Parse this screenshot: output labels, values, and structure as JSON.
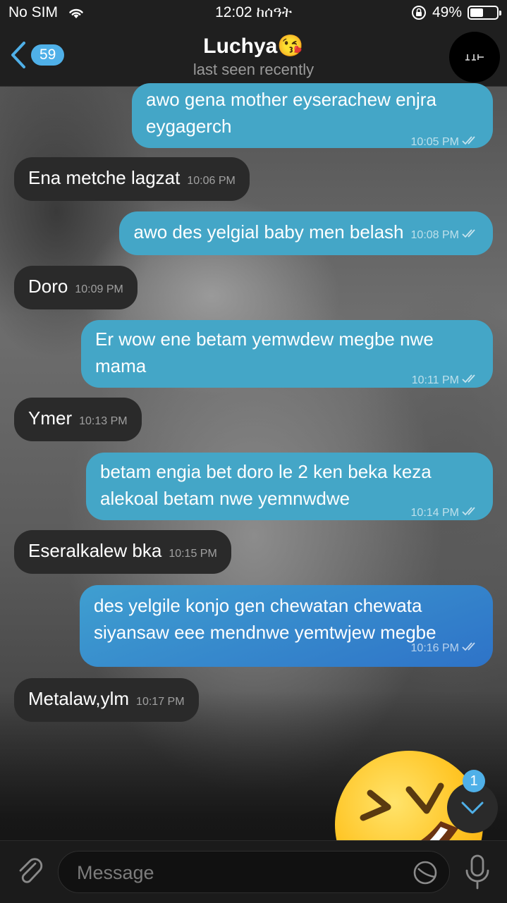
{
  "status_bar": {
    "carrier": "No SIM",
    "time": "12:02 ከሰዓት",
    "battery": "49%",
    "battery_level": 0.49
  },
  "header": {
    "back_count": "59",
    "title": "Luchya😘",
    "subtitle": "last seen recently"
  },
  "messages": [
    {
      "dir": "out",
      "text": "awo gena mother eyserachew enjra eygagerch",
      "time": "10:05 PM"
    },
    {
      "dir": "in",
      "text": "Ena metche lagzat",
      "time": "10:06 PM"
    },
    {
      "dir": "out",
      "text": "awo des yelgial baby men belash",
      "time": "10:08 PM"
    },
    {
      "dir": "in",
      "text": "Doro",
      "time": "10:09 PM"
    },
    {
      "dir": "out",
      "text": "Er wow ene betam yemwdew megbe nwe mama",
      "time": "10:11 PM"
    },
    {
      "dir": "in",
      "text": "Ymer",
      "time": "10:13 PM"
    },
    {
      "dir": "out",
      "text": "betam engia bet doro le 2 ken beka keza alekoal betam nwe yemnwdwe",
      "time": "10:14 PM"
    },
    {
      "dir": "in",
      "text": "Eseralkalew bka",
      "time": "10:15 PM"
    },
    {
      "dir": "out",
      "text": "des yelgile konjo gen chewatan chewata siyansaw eee mendnwe yemtwjew megbe",
      "time": "10:16 PM"
    },
    {
      "dir": "in",
      "text": "Metalaw,ylm",
      "time": "10:17 PM"
    }
  ],
  "scroll": {
    "unread": "1"
  },
  "input": {
    "placeholder": "Message"
  },
  "colors": {
    "accent": "#4fb0e8",
    "outgoing_bubble": "#44a6c7",
    "incoming_bubble": "#2a2a2a"
  }
}
